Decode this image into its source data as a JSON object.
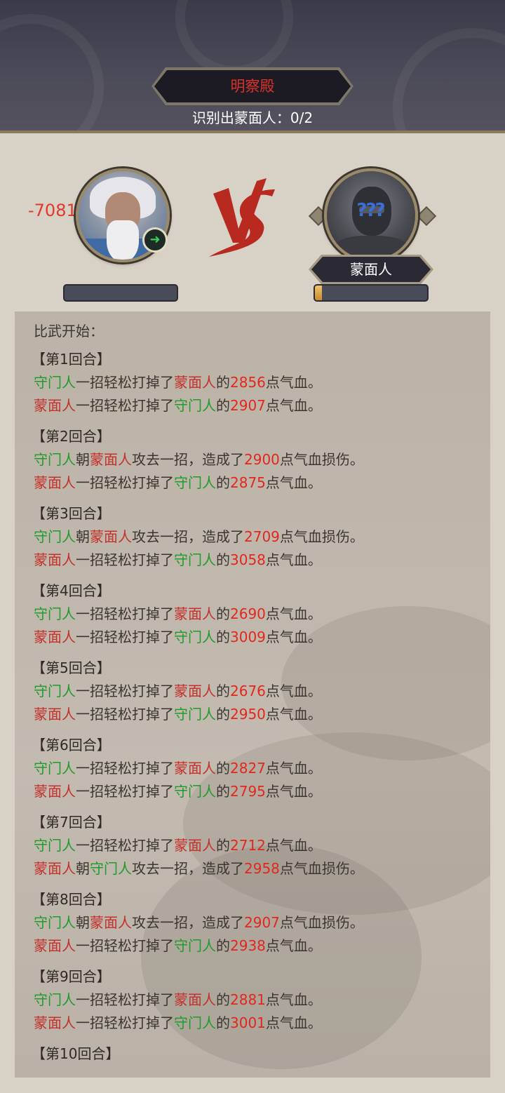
{
  "header": {
    "title": "明察殿",
    "progress": "识别出蒙面人：0/2"
  },
  "battle": {
    "left_damage": "-7081",
    "left_badge_icon": "speed-boot-icon",
    "right_question": "???",
    "right_name": "蒙面人",
    "left_hp_fraction": 0,
    "right_hp_fraction": 0.06
  },
  "log": {
    "start": "比武开始：",
    "rounds": [
      {
        "title": "【第1回合】",
        "lines": [
          {
            "a": "守门人",
            "verb": "一招轻松打掉了",
            "b": "蒙面人",
            "mid": "的",
            "num": "2856",
            "tail": "点气血。",
            "a_color": "g",
            "b_color": "r"
          },
          {
            "a": "蒙面人",
            "verb": "一招轻松打掉了",
            "b": "守门人",
            "mid": "的",
            "num": "2907",
            "tail": "点气血。",
            "a_color": "r",
            "b_color": "g"
          }
        ]
      },
      {
        "title": "【第2回合】",
        "lines": [
          {
            "a": "守门人",
            "verb": "朝",
            "b": "蒙面人",
            "mid": "攻去一招，造成了",
            "num": "2900",
            "tail": "点气血损伤。",
            "a_color": "g",
            "b_color": "r"
          },
          {
            "a": "蒙面人",
            "verb": "一招轻松打掉了",
            "b": "守门人",
            "mid": "的",
            "num": "2875",
            "tail": "点气血。",
            "a_color": "r",
            "b_color": "g"
          }
        ]
      },
      {
        "title": "【第3回合】",
        "lines": [
          {
            "a": "守门人",
            "verb": "朝",
            "b": "蒙面人",
            "mid": "攻去一招，造成了",
            "num": "2709",
            "tail": "点气血损伤。",
            "a_color": "g",
            "b_color": "r"
          },
          {
            "a": "蒙面人",
            "verb": "一招轻松打掉了",
            "b": "守门人",
            "mid": "的",
            "num": "3058",
            "tail": "点气血。",
            "a_color": "r",
            "b_color": "g"
          }
        ]
      },
      {
        "title": "【第4回合】",
        "lines": [
          {
            "a": "守门人",
            "verb": "一招轻松打掉了",
            "b": "蒙面人",
            "mid": "的",
            "num": "2690",
            "tail": "点气血。",
            "a_color": "g",
            "b_color": "r"
          },
          {
            "a": "蒙面人",
            "verb": "一招轻松打掉了",
            "b": "守门人",
            "mid": "的",
            "num": "3009",
            "tail": "点气血。",
            "a_color": "r",
            "b_color": "g"
          }
        ]
      },
      {
        "title": "【第5回合】",
        "lines": [
          {
            "a": "守门人",
            "verb": "一招轻松打掉了",
            "b": "蒙面人",
            "mid": "的",
            "num": "2676",
            "tail": "点气血。",
            "a_color": "g",
            "b_color": "r"
          },
          {
            "a": "蒙面人",
            "verb": "一招轻松打掉了",
            "b": "守门人",
            "mid": "的",
            "num": "2950",
            "tail": "点气血。",
            "a_color": "r",
            "b_color": "g"
          }
        ]
      },
      {
        "title": "【第6回合】",
        "lines": [
          {
            "a": "守门人",
            "verb": "一招轻松打掉了",
            "b": "蒙面人",
            "mid": "的",
            "num": "2827",
            "tail": "点气血。",
            "a_color": "g",
            "b_color": "r"
          },
          {
            "a": "蒙面人",
            "verb": "一招轻松打掉了",
            "b": "守门人",
            "mid": "的",
            "num": "2795",
            "tail": "点气血。",
            "a_color": "r",
            "b_color": "g"
          }
        ]
      },
      {
        "title": "【第7回合】",
        "lines": [
          {
            "a": "守门人",
            "verb": "一招轻松打掉了",
            "b": "蒙面人",
            "mid": "的",
            "num": "2712",
            "tail": "点气血。",
            "a_color": "g",
            "b_color": "r"
          },
          {
            "a": "蒙面人",
            "verb": "朝",
            "b": "守门人",
            "mid": "攻去一招，造成了",
            "num": "2958",
            "tail": "点气血损伤。",
            "a_color": "r",
            "b_color": "g"
          }
        ]
      },
      {
        "title": "【第8回合】",
        "lines": [
          {
            "a": "守门人",
            "verb": "朝",
            "b": "蒙面人",
            "mid": "攻去一招，造成了",
            "num": "2907",
            "tail": "点气血损伤。",
            "a_color": "g",
            "b_color": "r"
          },
          {
            "a": "蒙面人",
            "verb": "一招轻松打掉了",
            "b": "守门人",
            "mid": "的",
            "num": "2938",
            "tail": "点气血。",
            "a_color": "r",
            "b_color": "g"
          }
        ]
      },
      {
        "title": "【第9回合】",
        "lines": [
          {
            "a": "守门人",
            "verb": "一招轻松打掉了",
            "b": "蒙面人",
            "mid": "的",
            "num": "2881",
            "tail": "点气血。",
            "a_color": "g",
            "b_color": "r"
          },
          {
            "a": "蒙面人",
            "verb": "一招轻松打掉了",
            "b": "守门人",
            "mid": "的",
            "num": "3001",
            "tail": "点气血。",
            "a_color": "r",
            "b_color": "g"
          }
        ]
      },
      {
        "title": "【第10回合】",
        "lines": []
      }
    ]
  }
}
